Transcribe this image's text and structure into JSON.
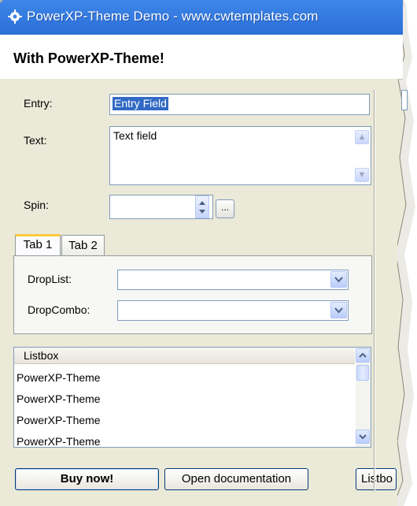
{
  "window": {
    "title": "PowerXP-Theme Demo - www.cwtemplates.com",
    "icon": "gear-icon",
    "header": "With PowerXP-Theme!"
  },
  "form": {
    "entry": {
      "label": "Entry:",
      "value": "Entry Field"
    },
    "text": {
      "label": "Text:",
      "value": "Text field"
    },
    "spin": {
      "label": "Spin:",
      "value": "",
      "button_label": "..."
    }
  },
  "tabs": {
    "items": [
      {
        "label": "Tab 1",
        "active": true
      },
      {
        "label": "Tab 2",
        "active": false
      }
    ],
    "droplist": {
      "label": "DropList:",
      "value": ""
    },
    "dropcombo": {
      "label": "DropCombo:",
      "value": ""
    }
  },
  "listbox": {
    "header": "Listbox",
    "rows": [
      "PowerXP-Theme",
      "PowerXP-Theme",
      "PowerXP-Theme",
      "PowerXP-Theme"
    ]
  },
  "buttons": {
    "buy": "Buy now!",
    "docs": "Open documentation",
    "listbox": "Listbo"
  },
  "colors": {
    "titlebar": "#2b6fd8",
    "client": "#ebe9d8",
    "selection": "#316ac5",
    "tab_highlight": "#ffc83c"
  }
}
